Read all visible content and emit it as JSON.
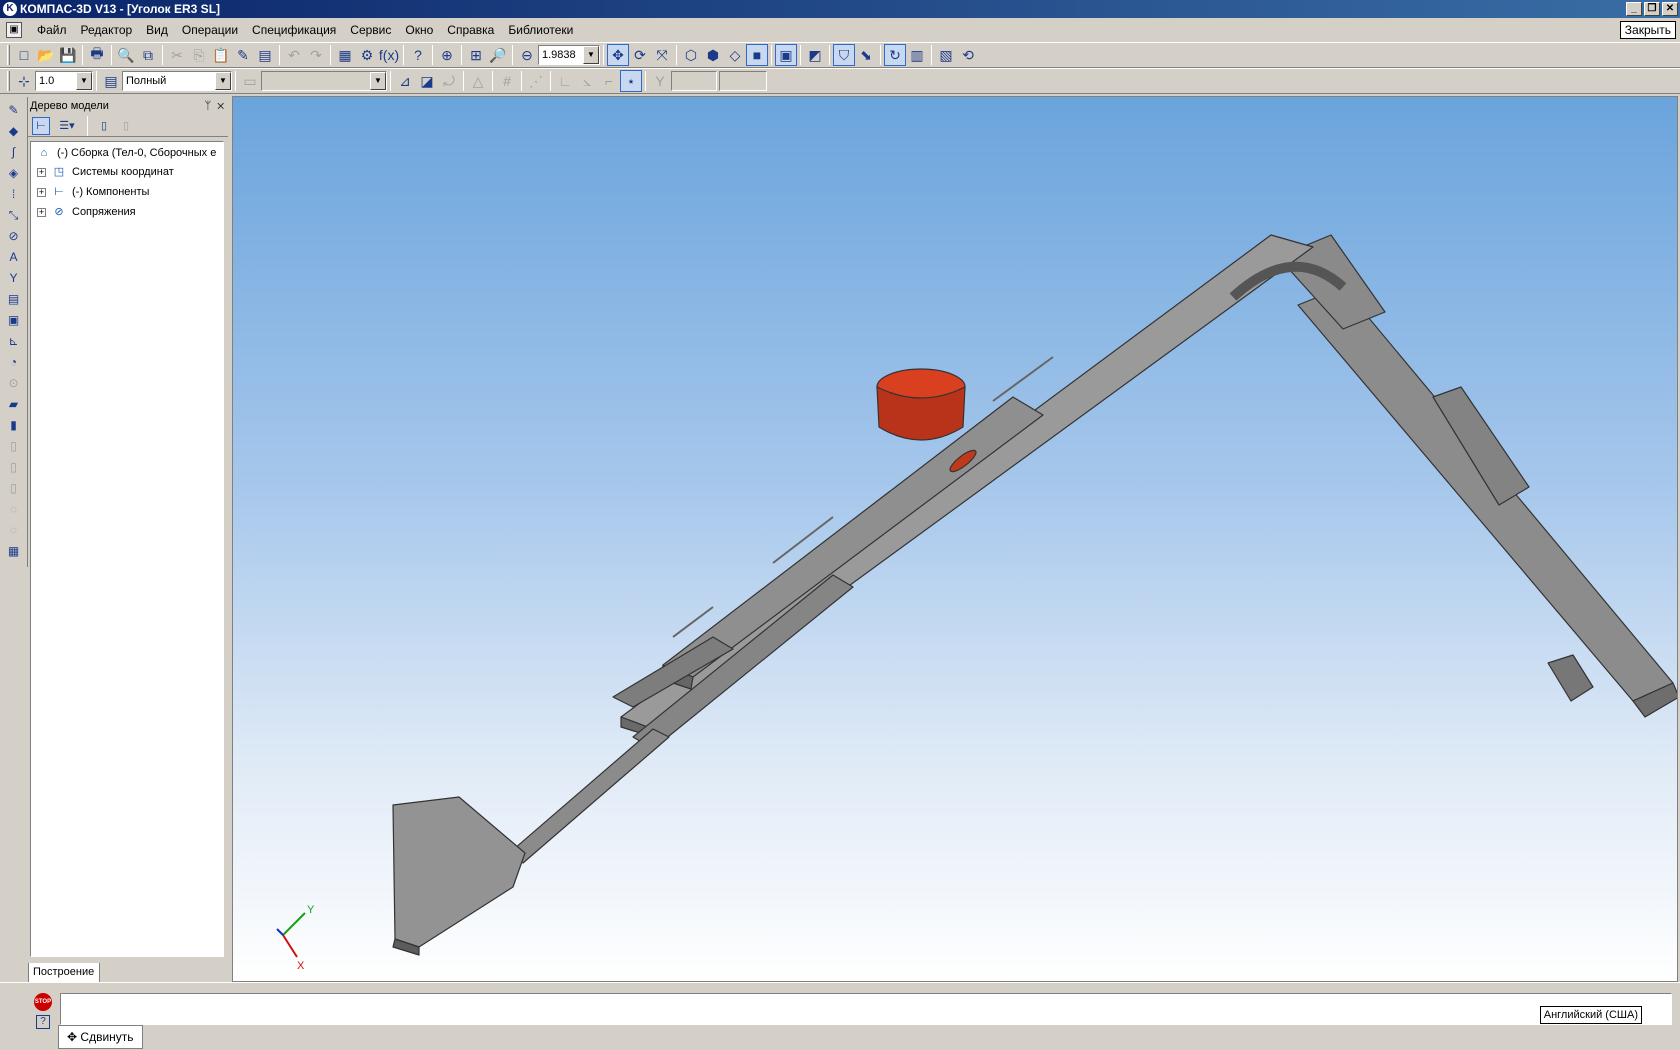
{
  "window": {
    "title": "КОМПАС-3D V13 - [Уголок ER3 SL]"
  },
  "menu": [
    "Файл",
    "Редактор",
    "Вид",
    "Операции",
    "Спецификация",
    "Сервис",
    "Окно",
    "Справка",
    "Библиотеки"
  ],
  "close_tooltip": "Закрыть",
  "toolbar": {
    "zoom_value": "1.9838"
  },
  "toolbar2": {
    "step_value": "1.0",
    "mode_value": "Полный"
  },
  "tree": {
    "title": "Дерево модели",
    "items": [
      {
        "label": "(-) Сборка (Тел-0, Сборочных е",
        "icon": "assembly-icon"
      },
      {
        "label": "Системы координат",
        "icon": "coordinate-systems-icon"
      },
      {
        "label": "(-) Компоненты",
        "icon": "components-icon"
      },
      {
        "label": "Сопряжения",
        "icon": "mates-icon"
      }
    ],
    "tab": "Построение"
  },
  "viewport": {
    "axis_x": "X",
    "axis_y": "Y",
    "part_color": "#8c8c8c",
    "accent_color": "#c0391b"
  },
  "status": {
    "language": "Английский (США)",
    "stop_label": "STOP",
    "move_button": "Сдвинуть"
  }
}
